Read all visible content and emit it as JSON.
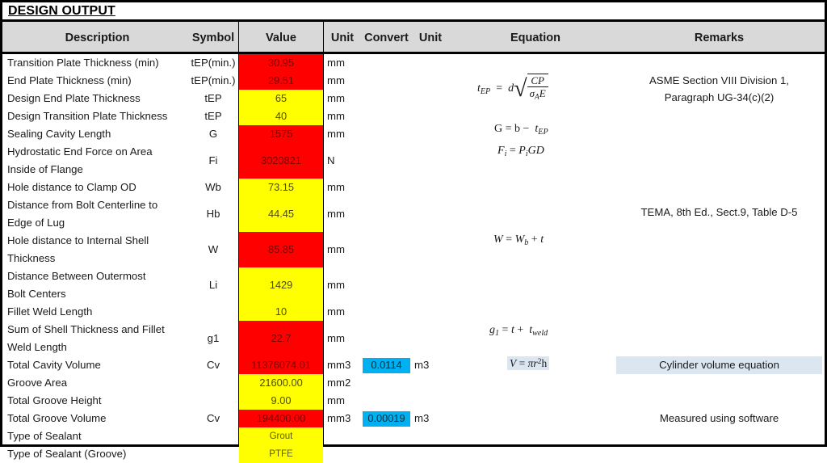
{
  "title": "DESIGN OUTPUT",
  "header": {
    "description": "Description",
    "symbol": "Symbol",
    "value": "Value",
    "unit": "Unit",
    "convert": "Convert",
    "unit2": "Unit"
  },
  "colors": {
    "red_fill": "#FF0000",
    "yellow_fill": "#FFFF00",
    "convert_fill": "#00B0F0",
    "header_fill": "#D9D9D9",
    "highlight": "#DCE6F1"
  },
  "rows": [
    {
      "desc": "Transition Plate Thickness (min)",
      "symbol": "tEP(min.)",
      "value": "30.95",
      "unit": "mm",
      "fill": "red"
    },
    {
      "desc": "End Plate Thickness (min)",
      "symbol": "tEP(min.)",
      "value": "29.51",
      "unit": "mm",
      "fill": "red"
    },
    {
      "desc": "Design End Plate Thickness",
      "symbol": "tEP",
      "value": "65",
      "unit": "mm",
      "fill": "yellow"
    },
    {
      "desc": "Design Transition Plate Thickness",
      "symbol": "tEP",
      "value": "40",
      "unit": "mm",
      "fill": "yellow"
    },
    {
      "desc": "Sealing Cavity Length",
      "symbol": "G",
      "value": "1575",
      "unit": "mm",
      "fill": "red"
    },
    {
      "desc": "Hydrostatic End Force on Area",
      "desc2": "Inside of Flange",
      "symbol": "Fi",
      "value": "3020821",
      "unit": "N",
      "fill": "red"
    },
    {
      "desc": "Hole distance to Clamp OD",
      "symbol": "Wb",
      "value": "73.15",
      "unit": "mm",
      "fill": "yellow"
    },
    {
      "desc": "Distance from Bolt Centerline to",
      "desc2": "Edge of Lug",
      "symbol": "Hb",
      "value": "44.45",
      "unit": "mm",
      "fill": "yellow"
    },
    {
      "desc": "Hole distance to Internal Shell",
      "desc2": "Thickness",
      "symbol": "W",
      "value": "85.85",
      "unit": "mm",
      "fill": "red"
    },
    {
      "desc": "Distance Between Outermost",
      "desc2": "Bolt Centers",
      "symbol": "Li",
      "value": "1429",
      "unit": "mm",
      "fill": "yellow"
    },
    {
      "desc": "Fillet Weld Length",
      "symbol": "",
      "value": "10",
      "unit": "mm",
      "fill": "yellow"
    },
    {
      "desc": "Sum of Shell Thickness and Fillet",
      "desc2": "Weld Length",
      "symbol": "g1",
      "value": "22.7",
      "unit": "mm",
      "fill": "red"
    },
    {
      "desc": "Total Cavity Volume",
      "symbol": "Cv",
      "value": "11376074.01",
      "unit": "mm3",
      "convert": "0.0114",
      "unit2": "m3",
      "fill": "red"
    },
    {
      "desc": "Groove Area",
      "symbol": "",
      "value": "21600.00",
      "unit": "mm2",
      "fill": "yellow"
    },
    {
      "desc": "Total Groove Height",
      "symbol": "",
      "value": "9.00",
      "unit": "mm",
      "fill": "yellow"
    },
    {
      "desc": "Total Groove Volume",
      "symbol": "Cv",
      "value": "194400.00",
      "unit": "mm3",
      "convert": "0.00019",
      "unit2": "m3",
      "fill": "red"
    },
    {
      "desc": "Type of Sealant",
      "symbol": "",
      "value": "Grout",
      "unit": "",
      "fill": "yellow",
      "small": true
    },
    {
      "desc": "Type of Sealant (Groove)",
      "symbol": "",
      "value": "PTFE",
      "unit": "",
      "fill": "yellow",
      "small": true
    }
  ],
  "equations": [
    {
      "id": "tep",
      "latex": "t_EP = d sqrt( CP / (sigma_A E) )"
    },
    {
      "id": "g",
      "latex": "G = b - t_EP"
    },
    {
      "id": "fi",
      "latex": "F_i = P_i G D"
    },
    {
      "id": "w",
      "latex": "W = W_b + t"
    },
    {
      "id": "g1",
      "latex": "g_1 = t + t_weld"
    },
    {
      "id": "v",
      "latex": "V = pi r^2 h"
    }
  ],
  "remarks": [
    {
      "id": "asme",
      "line1": "ASME Section VIII Division 1,",
      "line2": "Paragraph UG-34(c)(2)"
    },
    {
      "id": "tema",
      "line1": "TEMA, 8th Ed., Sect.9, Table D-5"
    },
    {
      "id": "cylinder",
      "line1": "Cylinder volume equation",
      "highlight": true
    },
    {
      "id": "software",
      "line1": "Measured using software"
    }
  ]
}
